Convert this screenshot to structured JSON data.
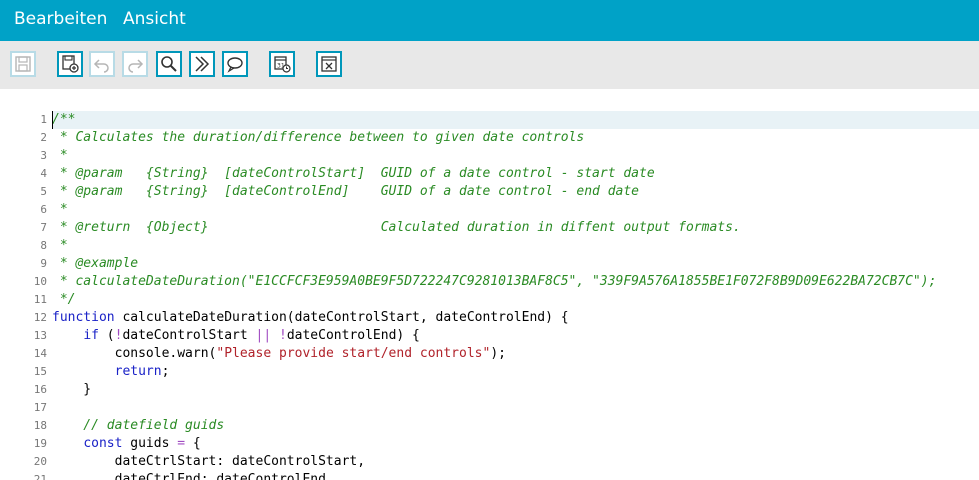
{
  "menu": {
    "items": [
      {
        "label": "Bearbeiten"
      },
      {
        "label": "Ansicht"
      }
    ]
  },
  "toolbar": {
    "buttons": [
      {
        "icon": "save-icon",
        "enabled": false
      },
      {
        "icon": "save-copy-icon",
        "enabled": true
      },
      {
        "icon": "undo-icon",
        "enabled": false
      },
      {
        "icon": "redo-icon",
        "enabled": false
      },
      {
        "icon": "search-icon",
        "enabled": true
      },
      {
        "icon": "jump-forward-icon",
        "enabled": true
      },
      {
        "icon": "comment-icon",
        "enabled": true
      },
      {
        "icon": "date-picker-icon",
        "enabled": true
      },
      {
        "icon": "fullscreen-icon",
        "enabled": true
      }
    ]
  },
  "editor": {
    "active_line": 1,
    "lines": [
      {
        "n": "1",
        "tokens": [
          {
            "t": "/**",
            "c": "cm"
          }
        ]
      },
      {
        "n": "2",
        "tokens": [
          {
            "t": " * Calculates the duration/difference between to given date controls",
            "c": "cm"
          }
        ]
      },
      {
        "n": "3",
        "tokens": [
          {
            "t": " *",
            "c": "cm"
          }
        ]
      },
      {
        "n": "4",
        "tokens": [
          {
            "t": " * @param   {String}  [dateControlStart]  GUID of a date control - start date",
            "c": "cm"
          }
        ]
      },
      {
        "n": "5",
        "tokens": [
          {
            "t": " * @param   {String}  [dateControlEnd]    GUID of a date control - end date",
            "c": "cm"
          }
        ]
      },
      {
        "n": "6",
        "tokens": [
          {
            "t": " *",
            "c": "cm"
          }
        ]
      },
      {
        "n": "7",
        "tokens": [
          {
            "t": " * @return  {Object}                      Calculated duration in diffent output formats.",
            "c": "cm"
          }
        ]
      },
      {
        "n": "8",
        "tokens": [
          {
            "t": " *",
            "c": "cm"
          }
        ]
      },
      {
        "n": "9",
        "tokens": [
          {
            "t": " * @example",
            "c": "cm"
          }
        ]
      },
      {
        "n": "10",
        "tokens": [
          {
            "t": " * calculateDateDuration(\"E1CCFCF3E959A0BE9F5D722247C9281013BAF8C5\", \"339F9A576A1855BE1F072F8B9D09E622BA72CB7C\");",
            "c": "cm"
          }
        ]
      },
      {
        "n": "11",
        "tokens": [
          {
            "t": " */",
            "c": "cm"
          }
        ]
      },
      {
        "n": "12",
        "tokens": [
          {
            "t": "function",
            "c": "kw"
          },
          {
            "t": " calculateDateDuration(dateControlStart, dateControlEnd) {",
            "c": ""
          }
        ]
      },
      {
        "n": "13",
        "tokens": [
          {
            "t": "    ",
            "c": ""
          },
          {
            "t": "if",
            "c": "kw"
          },
          {
            "t": " (",
            "c": ""
          },
          {
            "t": "!",
            "c": "op"
          },
          {
            "t": "dateControlStart ",
            "c": ""
          },
          {
            "t": "||",
            "c": "op"
          },
          {
            "t": " ",
            "c": ""
          },
          {
            "t": "!",
            "c": "op"
          },
          {
            "t": "dateControlEnd) {",
            "c": ""
          }
        ]
      },
      {
        "n": "14",
        "tokens": [
          {
            "t": "        console.warn(",
            "c": ""
          },
          {
            "t": "\"Please provide start/end controls\"",
            "c": "str"
          },
          {
            "t": ");",
            "c": ""
          }
        ]
      },
      {
        "n": "15",
        "tokens": [
          {
            "t": "        ",
            "c": ""
          },
          {
            "t": "return",
            "c": "kw"
          },
          {
            "t": ";",
            "c": ""
          }
        ]
      },
      {
        "n": "16",
        "tokens": [
          {
            "t": "    }",
            "c": ""
          }
        ]
      },
      {
        "n": "17",
        "tokens": [
          {
            "t": "",
            "c": ""
          }
        ]
      },
      {
        "n": "18",
        "tokens": [
          {
            "t": "    // datefield guids",
            "c": "cm"
          }
        ]
      },
      {
        "n": "19",
        "tokens": [
          {
            "t": "    ",
            "c": ""
          },
          {
            "t": "const",
            "c": "kw"
          },
          {
            "t": " guids ",
            "c": ""
          },
          {
            "t": "=",
            "c": "op"
          },
          {
            "t": " {",
            "c": ""
          }
        ]
      },
      {
        "n": "20",
        "tokens": [
          {
            "t": "        dateCtrlStart: dateControlStart,",
            "c": ""
          }
        ]
      },
      {
        "n": "21",
        "tokens": [
          {
            "t": "        dateCtrlEnd: dateControlEnd",
            "c": ""
          }
        ]
      }
    ]
  }
}
